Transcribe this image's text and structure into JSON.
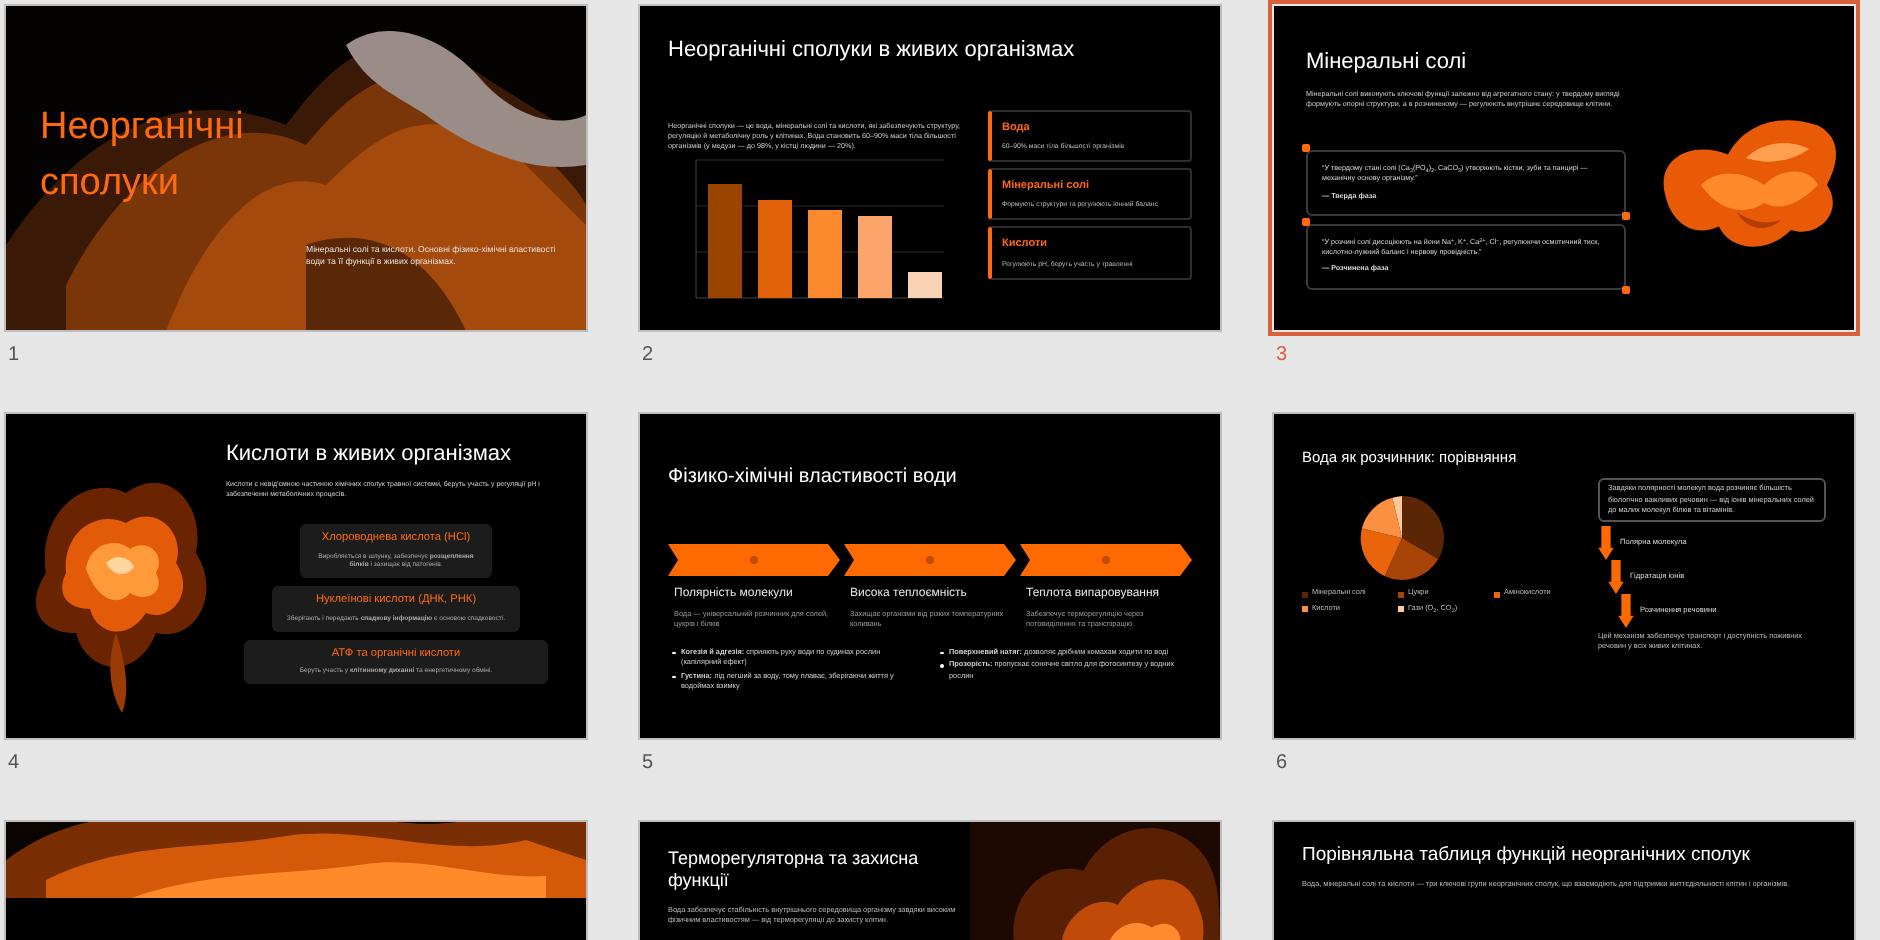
{
  "slides": [
    {
      "number": "1",
      "selected": false,
      "kind": "title",
      "title": "Неорганічні сполуки",
      "subtitle": "Мінеральні солі та кислоти. Основні фізико-хімічні властивості води та її функції в живих організмах."
    },
    {
      "number": "2",
      "selected": false,
      "kind": "cards_chart",
      "title": "Неорганічні сполуки в живих організмах",
      "intro": "Неорганічні сполуки — це вода, мінеральні солі та кислоти, які забезпечують структуру, регуляцію й метаболічну роль у клітинах. Вода становить 60–90% маси тіла більшості організмів (у медузи — до 98%, у кістці людини — 20%).",
      "cards": [
        {
          "title": "Вода",
          "text": "60–90% маси тіла більшості організмів"
        },
        {
          "title": "Мінеральні солі",
          "text": "Формують структури та регулюють іонний баланс"
        },
        {
          "title": "Кислоти",
          "text": "Регулюють pH; беруть участь у травленні"
        }
      ]
    },
    {
      "number": "3",
      "selected": true,
      "kind": "quotes",
      "title": "Мінеральні солі",
      "intro": "Мінеральні солі виконують ключові функції залежно від агрегатного стану: у твердому вигляді формують опорні структури, а в розчиненому — регулюють внутрішнє середовище клітини.",
      "quotes": [
        {
          "text": "“У твердому стані солі (Ca$_{3}$(PO$_{4}$)$_{2}$, CaCO$_{3}$) утворюють кістки, зуби та панцирі — механічну основу організму.”",
          "author": "— Тверда фаза"
        },
        {
          "text": "“У розчині солі дисоціюють на йони Na$^{+}$, K$^{+}$, Ca$^{2+}$, Cl$^{−}$, регулюючи осмотичний тиск, кислотно-лужний баланс і нервову провідність.”",
          "author": "— Розчинена фаза"
        }
      ]
    },
    {
      "number": "4",
      "selected": false,
      "kind": "acids",
      "title": "Кислоти в живих організмах",
      "intro": "Кислоти є невід'ємною частиною хімічних сполук травної системи, беруть участь у регуляції pH і забезпеченні метаболічних процесів.",
      "cards": [
        {
          "title": "Хлороводнева кислота (HCl)",
          "text": "Виробляється в шлунку, забезпечує **розщеплення білків** і захищає від патогенів."
        },
        {
          "title": "Нуклеїнові кислоти (ДНК, РНК)",
          "text": "Зберігають і передають **спадкову інформацію** є основою спадковості."
        },
        {
          "title": "АТФ та органічні кислоти",
          "text": "Беруть участь у **клітинному диханні** та енергетичному обміні."
        }
      ]
    },
    {
      "number": "5",
      "selected": false,
      "kind": "chevrons",
      "title": "Фізико-хімічні властивості води",
      "steps": [
        {
          "title": "Полярність молекули",
          "text": "Вода — універсальний розчинник для солей, цукрів і білків"
        },
        {
          "title": "Висока теплоємність",
          "text": "Захищає організми від різких температурних коливань"
        },
        {
          "title": "Теплота випаровування",
          "text": "Забезпечує терморегуляцію через потовиділення та транспірацію"
        }
      ],
      "bullets": [
        [
          "**Когезія й адгезія:** сприяють руху води по судинах рослин (капілярний ефект)",
          "**Густина:** лід легший за воду, тому плаває, зберігаючи життя у водоймах взимку"
        ],
        [
          "**Поверхневий натяг:** дозволяє дрібним комахам ходити по воді",
          "**Прозорість:** пропускає сонячне світло для фотосинтезу у водних рослин"
        ]
      ]
    },
    {
      "number": "6",
      "selected": false,
      "kind": "pie_flow",
      "title": "Вода як розчинник: порівняння",
      "legend": [
        {
          "label": "Мінеральні солі",
          "color": "#5a2605"
        },
        {
          "label": "Цукри",
          "color": "#a84407"
        },
        {
          "label": "Амінокислоти",
          "color": "#e8650c"
        },
        {
          "label": "Кислоти",
          "color": "#fb9040"
        },
        {
          "label": "Гази (O$_{2}$, CO$_{2}$)",
          "color": "#fcc99a"
        }
      ],
      "note": "Завдяки полярності молекул вода розчиняє більшість біологічно важливих речовин — від іонів мінеральних солей до малих молекул білків та вітамінів.",
      "flow": [
        "Полярна молекула",
        "Гідратація іонів",
        "Розчинення речовини"
      ],
      "footer": "Цей механізм забезпечує транспорт і доступність поживних речовин у всіх живих клітинах."
    },
    {
      "selected": false,
      "kind": "picture"
    },
    {
      "selected": false,
      "kind": "text_picture",
      "title": "Терморегуляторна та захисна функції",
      "intro": "Вода забезпечує стабільність внутрішнього середовища організму завдяки високим фізичним властивостям — від терморегуляції до захисту клітин."
    },
    {
      "selected": false,
      "kind": "table_intro",
      "title": "Порівняльна таблиця функцій неорганічних сполук",
      "intro": "Вода, мінеральні солі та кислоти — три ключові групи неорганічних сполук, що взаємодіють для підтримки життєдіяльності клітин і організмів."
    }
  ]
}
